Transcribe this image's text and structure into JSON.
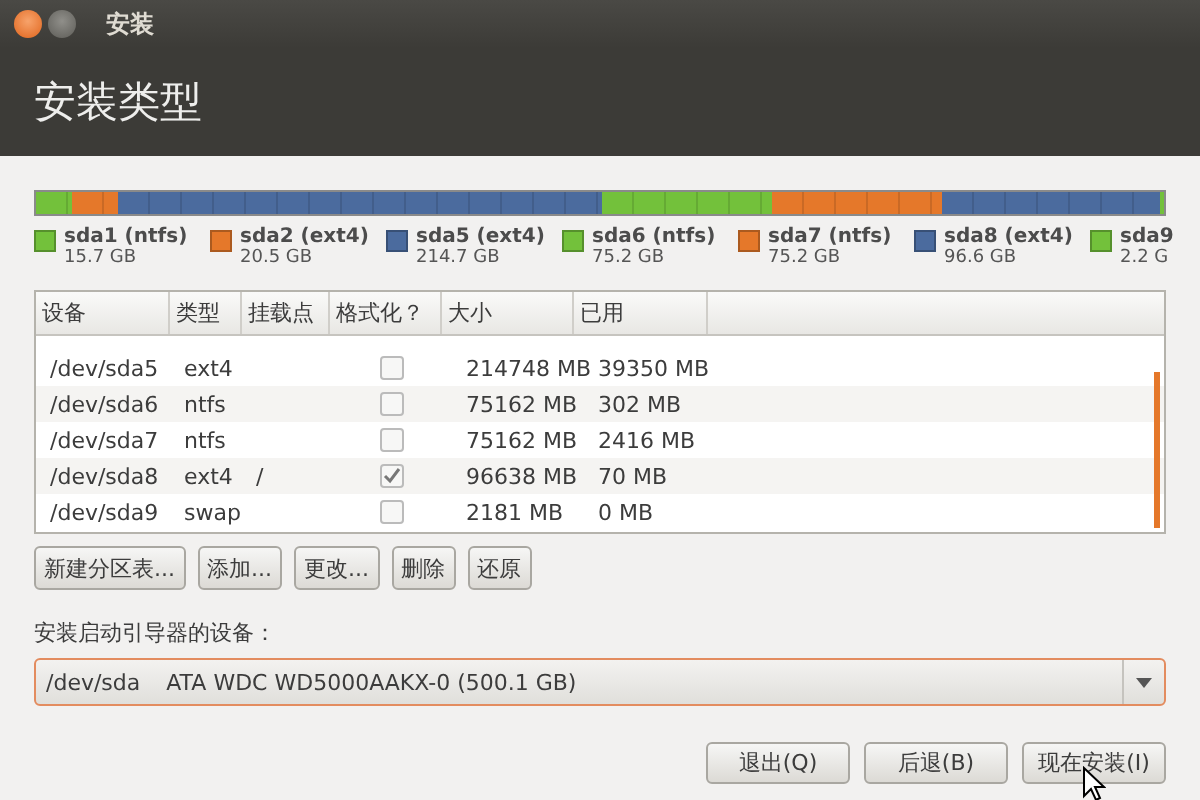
{
  "window": {
    "title": "安装"
  },
  "header": {
    "title": "安装类型"
  },
  "partitions": [
    {
      "name": "sda1 (ntfs)",
      "size": "15.7 GB",
      "color": "#73c13b"
    },
    {
      "name": "sda2 (ext4)",
      "size": "20.5 GB",
      "color": "#e5782a"
    },
    {
      "name": "sda5 (ext4)",
      "size": "214.7 GB",
      "color": "#4b6b9e"
    },
    {
      "name": "sda6 (ntfs)",
      "size": "75.2 GB",
      "color": "#73c13b"
    },
    {
      "name": "sda7 (ntfs)",
      "size": "75.2 GB",
      "color": "#e5782a"
    },
    {
      "name": "sda8 (ext4)",
      "size": "96.6 GB",
      "color": "#4b6b9e"
    },
    {
      "name": "sda9",
      "size": "2.2 G",
      "color": "#73c13b"
    }
  ],
  "table": {
    "columns": [
      "设备",
      "类型",
      "挂载点",
      "格式化？",
      "大小",
      "已用"
    ],
    "rows": [
      {
        "device": "/dev/sda5",
        "type": "ext4",
        "mount": "",
        "format": false,
        "size": "214748 MB",
        "used": "39350 MB"
      },
      {
        "device": "/dev/sda6",
        "type": "ntfs",
        "mount": "",
        "format": false,
        "size": "75162 MB",
        "used": "302 MB"
      },
      {
        "device": "/dev/sda7",
        "type": "ntfs",
        "mount": "",
        "format": false,
        "size": "75162 MB",
        "used": "2416 MB"
      },
      {
        "device": "/dev/sda8",
        "type": "ext4",
        "mount": "/",
        "format": true,
        "size": "96638 MB",
        "used": "70 MB"
      },
      {
        "device": "/dev/sda9",
        "type": "swap",
        "mount": "",
        "format": false,
        "size": "2181 MB",
        "used": "0 MB"
      }
    ]
  },
  "partition_buttons": [
    "新建分区表...",
    "添加...",
    "更改...",
    "删除",
    "还原"
  ],
  "boot_loader": {
    "label": "安装启动引导器的设备：",
    "device": "/dev/sda",
    "description": "ATA WDC WD5000AAKX-0 (500.1 GB)"
  },
  "buttons": [
    "退出(Q)",
    "后退(B)",
    "现在安装(I)"
  ]
}
